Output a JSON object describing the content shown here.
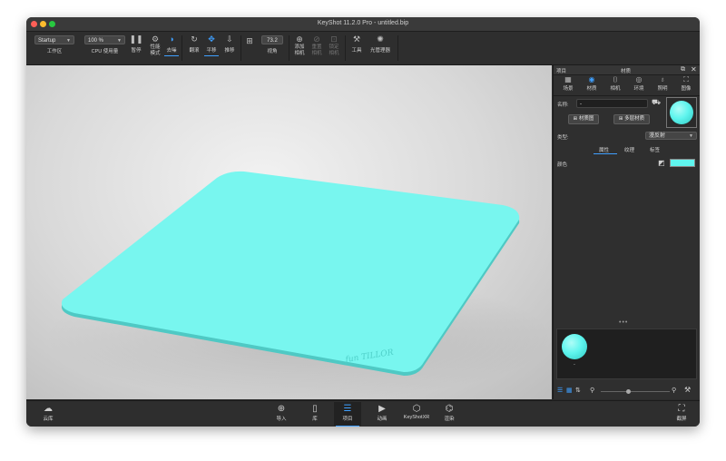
{
  "window": {
    "title": "KeyShot 11.2.0 Pro  - untitled.bip"
  },
  "toolbar": {
    "workspace_value": "Startup",
    "workspace_label": "工作区",
    "cpu_value": "100 %",
    "cpu_label": "CPU 使用量",
    "pause_label": "暂停",
    "perf_mode_label_1": "性能",
    "perf_mode_label_2": "模式",
    "denoise_label": "去噪",
    "tumble_label": "翻滚",
    "pan_label": "平移",
    "dolly_label": "推移",
    "fov_value": "73.2",
    "fov_label": "视角",
    "add_camera_label_1": "添加",
    "add_camera_label_2": "相机",
    "reset_camera_label_1": "重置",
    "reset_camera_label_2": "相机",
    "lock_camera_label_1": "锁定",
    "lock_camera_label_2": "相机",
    "tools_label": "工具",
    "light_manager_label": "光管理器"
  },
  "right_panel": {
    "header_left": "项目",
    "header_center": "材质",
    "tabs": [
      {
        "label": "场景",
        "icon": "scene-icon"
      },
      {
        "label": "材质",
        "icon": "material-icon"
      },
      {
        "label": "相机",
        "icon": "camera-icon"
      },
      {
        "label": "环境",
        "icon": "environment-icon"
      },
      {
        "label": "照明",
        "icon": "lighting-icon"
      },
      {
        "label": "图像",
        "icon": "image-icon"
      }
    ],
    "name_label": "名称:",
    "name_value": "-",
    "material_graph_btn": "材质图",
    "multi_material_btn": "多层材质",
    "type_label": "类型:",
    "type_value": "漫反射",
    "subtabs": [
      "属性",
      "纹理",
      "标签"
    ],
    "color_label": "颜色",
    "swatch_color": "#5ff5ee",
    "thumb_label": "-"
  },
  "bottom": {
    "cloud_label": "云库",
    "import_label": "导入",
    "library_label": "库",
    "project_label": "项目",
    "animation_label": "动画",
    "keyshotxr_label": "KeyShotXR",
    "render_label": "渲染",
    "screenshot_label": "截屏"
  },
  "viewport": {
    "mat_color": "#78f6ef",
    "logo_text": "fun TILLOR"
  }
}
